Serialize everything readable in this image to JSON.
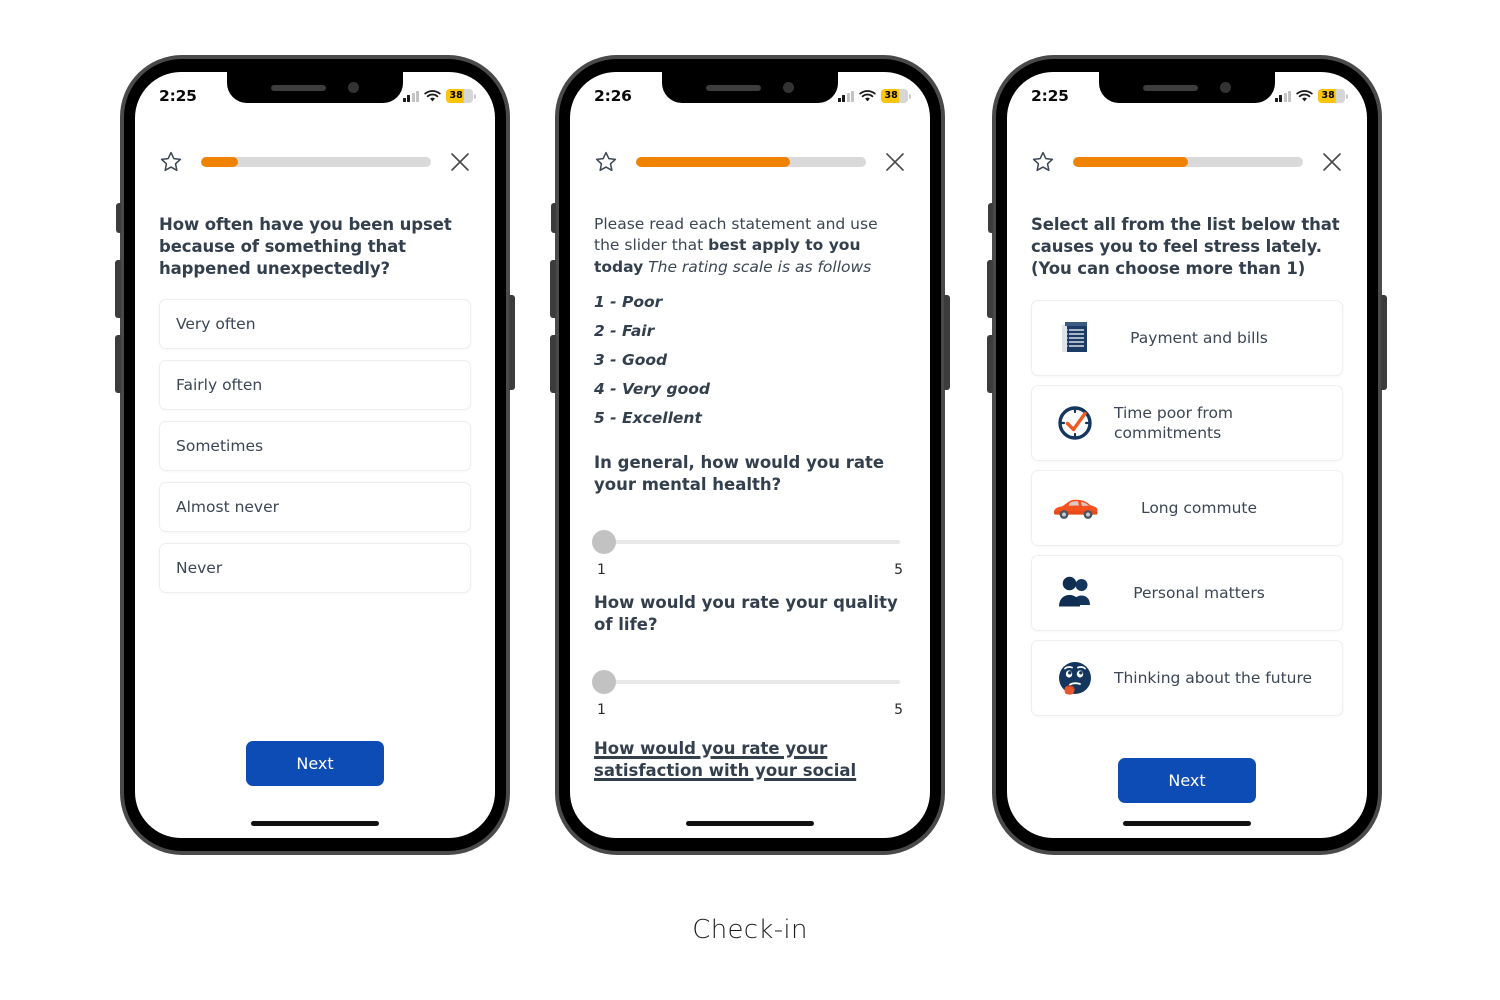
{
  "caption": "Check-in",
  "colors": {
    "progress_accent": "#ef8200",
    "primary_button": "#0e4cb5",
    "heading_text": "#333f4d",
    "body_text": "#3c4654",
    "battery_low_power": "#fcc40a"
  },
  "phones": [
    {
      "status": {
        "time": "2:25",
        "battery": "38"
      },
      "topbar": {
        "star_icon": "star-outline-icon",
        "close_icon": "close-icon",
        "progress_percent": 16
      },
      "question": "How often have you been upset because of something that happened unexpectedly?",
      "options": [
        "Very often",
        "Fairly often",
        "Sometimes",
        "Almost never",
        "Never"
      ],
      "next_label": "Next"
    },
    {
      "status": {
        "time": "2:26",
        "battery": "38"
      },
      "topbar": {
        "star_icon": "star-outline-icon",
        "close_icon": "close-icon",
        "progress_percent": 67
      },
      "intro": {
        "part1": "Please read each statement and use the slider that ",
        "bold": "best apply to you today",
        "italic": " The rating scale is as follows"
      },
      "scale": [
        "1 -  Poor",
        "2 - Fair",
        "3 - Good",
        "4 - Very good",
        "5 - Excellent"
      ],
      "sliders": [
        {
          "question": "In general, how would you rate your mental health?",
          "min_label": "1",
          "max_label": "5",
          "value": 1
        },
        {
          "question": "How would you rate your quality of life?",
          "min_label": "1",
          "max_label": "5",
          "value": 1
        }
      ],
      "cut_off_question": "How would you rate your satisfaction with your social"
    },
    {
      "status": {
        "time": "2:25",
        "battery": "38"
      },
      "topbar": {
        "star_icon": "star-outline-icon",
        "close_icon": "close-icon",
        "progress_percent": 50
      },
      "question": "Select all from the list below that causes you to feel stress lately. (You can choose more than 1)",
      "choices": [
        {
          "label": "Payment and bills",
          "icon": "invoice-icon"
        },
        {
          "label": "Time poor from commitments",
          "icon": "clock-check-icon"
        },
        {
          "label": "Long commute",
          "icon": "car-icon"
        },
        {
          "label": "Personal matters",
          "icon": "people-group-icon"
        },
        {
          "label": "Thinking about the future",
          "icon": "thinking-face-icon"
        }
      ],
      "next_label": "Next"
    }
  ]
}
